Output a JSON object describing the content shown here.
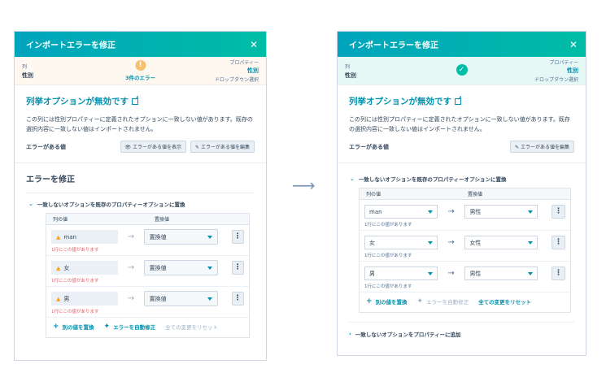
{
  "left": {
    "title": "インポートエラーを修正",
    "map": {
      "col_label": "列",
      "col_value": "性別",
      "error_count": "3件のエラー",
      "prop_label": "プロパティー",
      "prop_value": "性別",
      "prop_type": "ドロップダウン選択"
    },
    "heading": "列挙オプションが無効です",
    "description": "この列には性別プロパティーに定義されたオプションに一致しない値があります。既存の選択内容に一致しない値はインポートされません。",
    "errval_label": "エラーがある値",
    "show_button": "エラーがある値を表示",
    "edit_button": "エラーがある値を編集",
    "fix_title": "エラーを修正",
    "accordion": "一致しないオプションを既存のプロパティーオプションに置換",
    "col_header_1": "列の値",
    "col_header_2": "置換値",
    "rows": [
      {
        "value": "man",
        "replacement": "置換値",
        "error": "1行にこの値があります"
      },
      {
        "value": "女",
        "replacement": "置換値",
        "error": "1行にこの値があります"
      },
      {
        "value": "男",
        "replacement": "置換値",
        "error": "1行にこの値があります"
      }
    ],
    "action_replace": "別の値を置換",
    "action_autofix": "エラーを自動修正",
    "action_reset": "全ての変更をリセット"
  },
  "right": {
    "title": "インポートエラーを修正",
    "map": {
      "col_label": "列",
      "col_value": "性別",
      "prop_label": "プロパティー",
      "prop_value": "性別",
      "prop_type": "ドロップダウン選択"
    },
    "heading": "列挙オプションが無効です",
    "description": "この列には性別プロパティーに定義されたオプションに一致しない値があります。既存の選択内容に一致しない値はインポートされません。",
    "errval_label": "エラーがある値",
    "edit_button": "エラーがある値を編集",
    "accordion": "一致しないオプションを既存のプロパティーオプションに置換",
    "col_header_1": "列の値",
    "col_header_2": "置換値",
    "rows": [
      {
        "value": "man",
        "replacement": "男性",
        "note": "1行にこの値があります"
      },
      {
        "value": "女",
        "replacement": "女性",
        "note": "1行にこの値があります"
      },
      {
        "value": "男",
        "replacement": "男性",
        "note": "1行にこの値があります"
      }
    ],
    "action_replace": "別の値を置換",
    "action_autofix": "エラーを自動修正",
    "action_reset": "全ての変更をリセット",
    "accordion2": "一致しないオプションをプロパティーに追加"
  },
  "icons": {
    "close": "close-icon",
    "warning": "warning-icon",
    "check": "check-icon",
    "external": "external-link-icon",
    "arrow": "arrow-right-icon",
    "kebab": "more-options-icon"
  },
  "colors": {
    "header_start": "#00a4bd",
    "header_end": "#00bda5",
    "link": "#0091ae",
    "error": "#f2545b",
    "warning": "#f5c26b"
  }
}
